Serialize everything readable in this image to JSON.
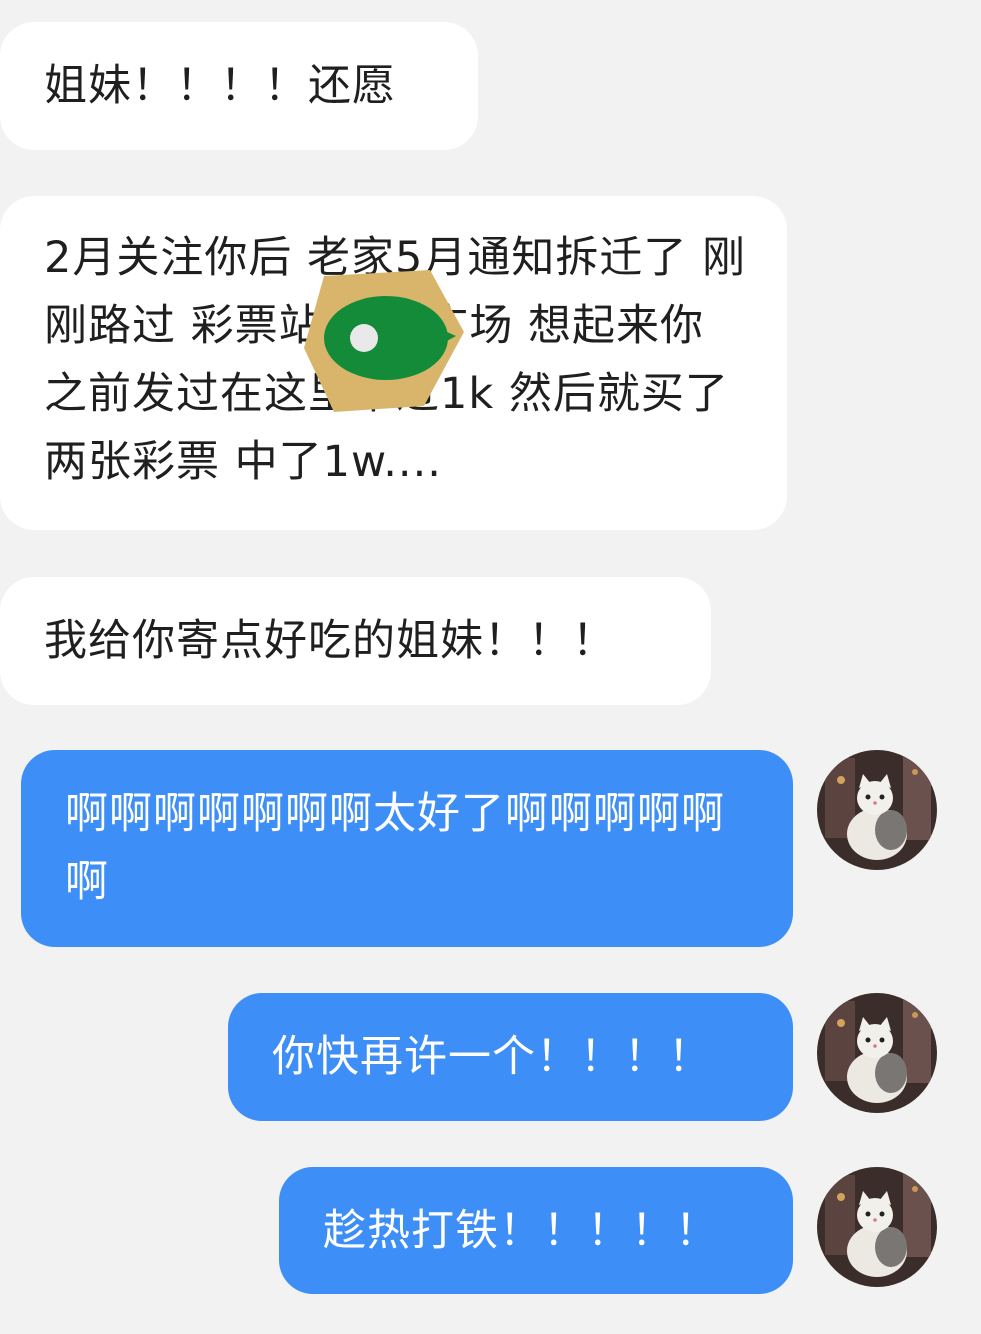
{
  "colors": {
    "background": "#f2f2f2",
    "incoming_bubble": "#ffffff",
    "outgoing_bubble": "#3d8ef7",
    "incoming_text": "#1f1f1f",
    "outgoing_text": "#ffffff"
  },
  "messages": [
    {
      "direction": "incoming",
      "text": "姐妹！！！！还愿"
    },
    {
      "direction": "incoming",
      "text": "2月关注你后 老家5月通知拆迁了 刚刚路过 彩票站 附近广场 想起来你之前发过在这里中过1k 然后就买了两张彩票 中了1w...."
    },
    {
      "direction": "incoming",
      "text": "我给你寄点好吃的姐妹！！！"
    },
    {
      "direction": "outgoing",
      "text": "啊啊啊啊啊啊啊太好了啊啊啊啊啊啊"
    },
    {
      "direction": "outgoing",
      "text": "你快再许一个！！！！"
    },
    {
      "direction": "outgoing",
      "text": "趁热打铁！！！！！"
    }
  ],
  "avatar": {
    "icon": "cat-avatar-icon"
  },
  "overlay": {
    "icon": "location-sticker-icon"
  }
}
